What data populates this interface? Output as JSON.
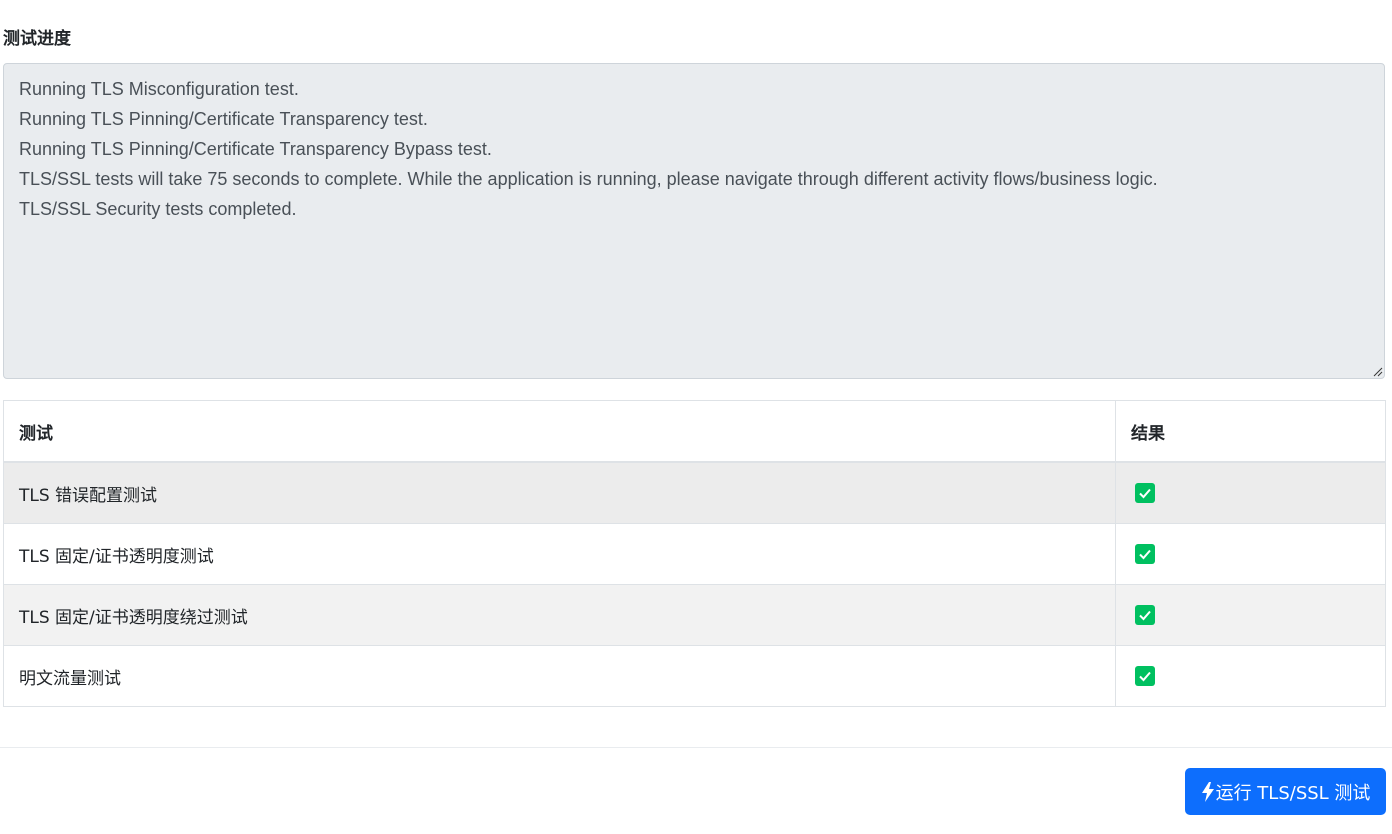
{
  "progress": {
    "label": "测试进度",
    "log_lines": [
      "Running TLS Misconfiguration test.",
      "Running TLS Pinning/Certificate Transparency test.",
      "Running TLS Pinning/Certificate Transparency Bypass test.",
      "TLS/SSL tests will take 75 seconds to complete. While the application is running, please navigate through different activity flows/business logic.",
      "TLS/SSL Security tests completed."
    ]
  },
  "table": {
    "headers": [
      "测试",
      "结果"
    ],
    "rows": [
      {
        "test": "TLS 错误配置测试",
        "result": "check-icon",
        "passed": true
      },
      {
        "test": "TLS 固定/证书透明度测试",
        "result": "check-icon",
        "passed": true
      },
      {
        "test": "TLS 固定/证书透明度绕过测试",
        "result": "check-icon",
        "passed": true
      },
      {
        "test": "明文流量测试",
        "result": "check-icon",
        "passed": true
      }
    ]
  },
  "actions": {
    "run_button_label": "运行 TLS/SSL 测试",
    "run_button_icon": "bolt-icon"
  },
  "colors": {
    "primary": "#0d6efd",
    "success": "#00c060",
    "log_background": "#e9ecef"
  }
}
